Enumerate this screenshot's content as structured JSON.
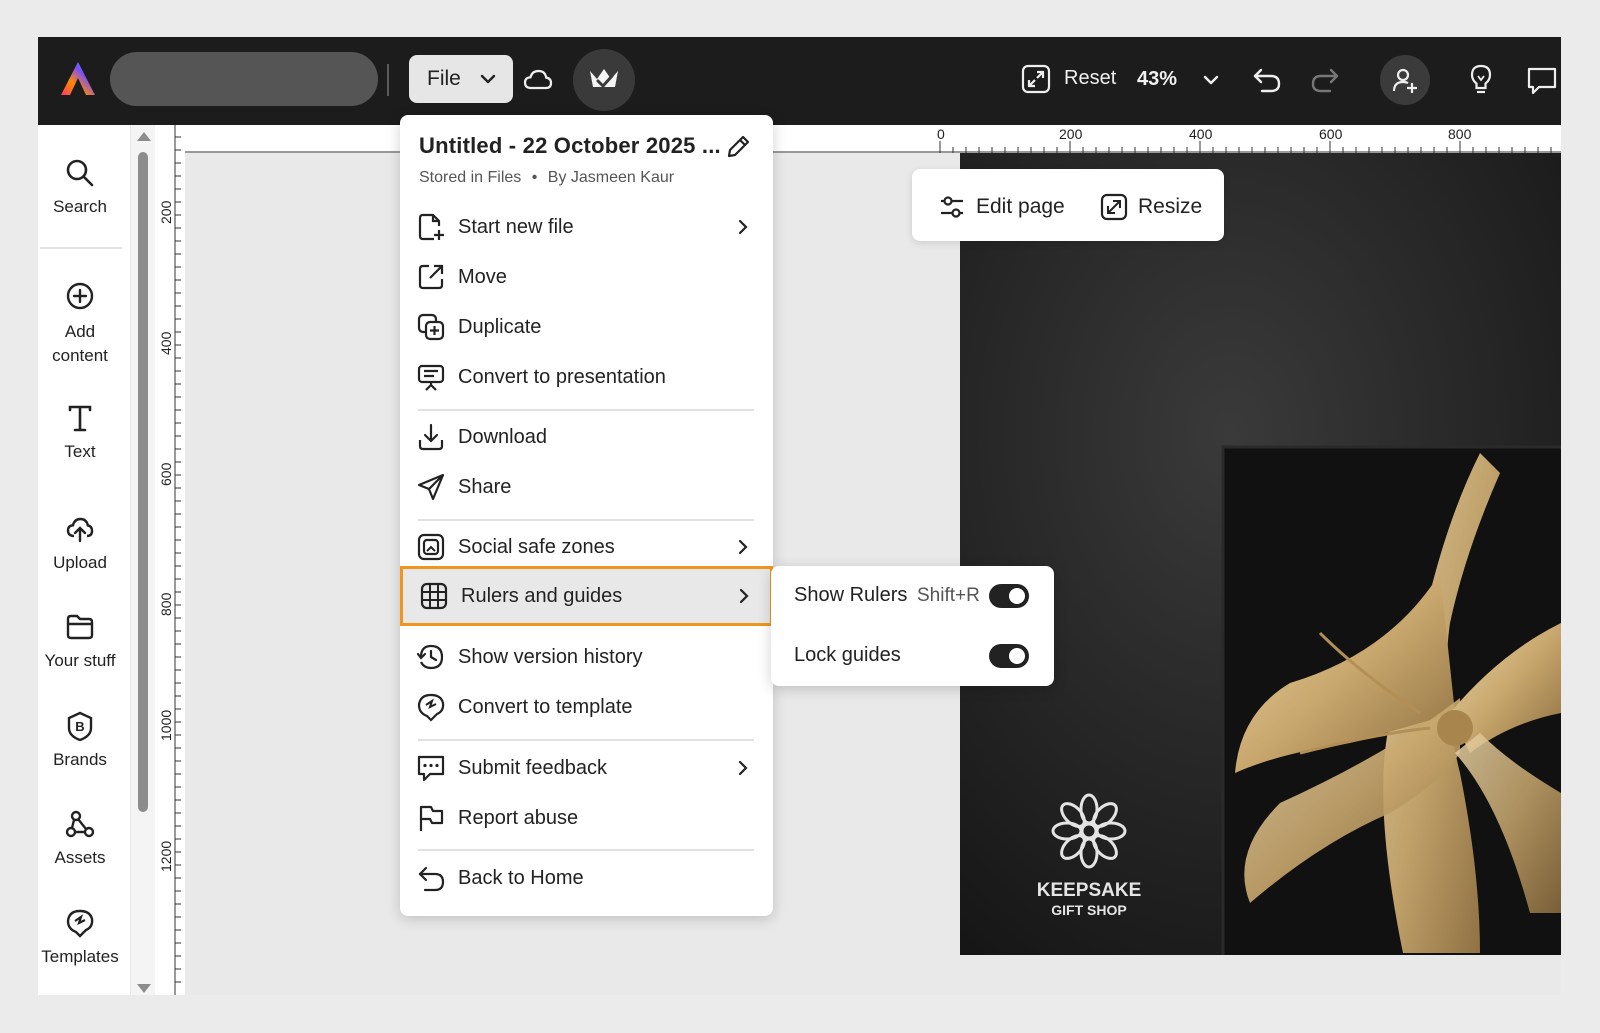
{
  "topbar": {
    "file_label": "File",
    "reset_label": "Reset",
    "zoom_label": "43%"
  },
  "rail": {
    "items": [
      {
        "label": "Search",
        "icon": "search-icon"
      },
      {
        "label": "Add content",
        "icon": "plus-circle-icon"
      },
      {
        "label": "Text",
        "icon": "text-icon"
      },
      {
        "label": "Upload",
        "icon": "upload-cloud-icon"
      },
      {
        "label": "Your stuff",
        "icon": "folder-icon"
      },
      {
        "label": "Brands",
        "icon": "brand-icon"
      },
      {
        "label": "Assets",
        "icon": "assets-icon"
      },
      {
        "label": "Templates",
        "icon": "templates-icon"
      }
    ]
  },
  "rulers": {
    "horizontal": [
      "0",
      "200",
      "400",
      "600",
      "800"
    ],
    "vertical": [
      "200",
      "400",
      "600",
      "800",
      "1000",
      "1200"
    ]
  },
  "edit_bar": {
    "edit_page": "Edit page",
    "resize": "Resize"
  },
  "menu": {
    "title": "Untitled - 22 October 2025 ...",
    "stored": "Stored in Files",
    "separator": "•",
    "author": "By Jasmeen Kaur",
    "items": [
      {
        "label": "Start new file",
        "icon": "new-file-icon",
        "submenu": true
      },
      {
        "label": "Move",
        "icon": "move-icon"
      },
      {
        "label": "Duplicate",
        "icon": "duplicate-icon"
      },
      {
        "label": "Convert to presentation",
        "icon": "presentation-icon"
      },
      {
        "label": "Download",
        "icon": "download-icon"
      },
      {
        "label": "Share",
        "icon": "share-icon"
      },
      {
        "label": "Social safe zones",
        "icon": "safe-zones-icon",
        "submenu": true
      },
      {
        "label": "Rulers and guides",
        "icon": "rulers-icon",
        "submenu": true,
        "highlighted": true
      },
      {
        "label": "Show version history",
        "icon": "history-icon"
      },
      {
        "label": "Convert to template",
        "icon": "template-icon"
      },
      {
        "label": "Submit feedback",
        "icon": "feedback-icon",
        "submenu": true
      },
      {
        "label": "Report abuse",
        "icon": "flag-icon"
      },
      {
        "label": "Back to Home",
        "icon": "back-icon"
      }
    ],
    "highlight_color": "#f0961e"
  },
  "submenu": {
    "show_rulers": "Show Rulers",
    "show_rulers_shortcut": "Shift+R",
    "show_rulers_on": true,
    "lock_guides": "Lock guides",
    "lock_guides_on": true
  },
  "artwork": {
    "brand_line1": "KEEPSAKE",
    "brand_line2": "GIFT SHOP"
  }
}
